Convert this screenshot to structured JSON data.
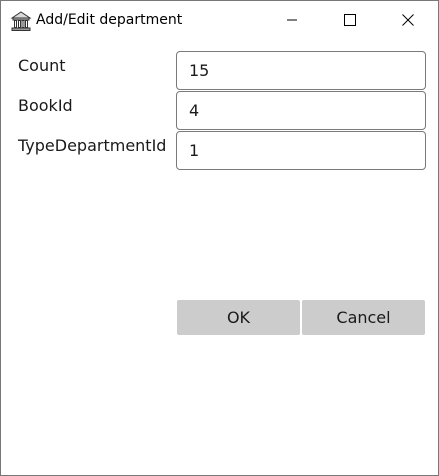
{
  "window": {
    "title": "Add/Edit department",
    "app_icon": "bank-building-icon",
    "controls": {
      "minimize_icon": "minimize-icon",
      "maximize_icon": "maximize-icon",
      "close_icon": "close-icon"
    }
  },
  "form": {
    "fields": [
      {
        "label": "Count",
        "value": "15"
      },
      {
        "label": "BookId",
        "value": "4"
      },
      {
        "label": "TypeDepartmentId",
        "value": "1"
      }
    ]
  },
  "actions": {
    "ok_label": "OK",
    "cancel_label": "Cancel"
  },
  "colors": {
    "button_bg": "#cccccc",
    "input_border": "#7a7a7a",
    "window_border": "#777777"
  }
}
